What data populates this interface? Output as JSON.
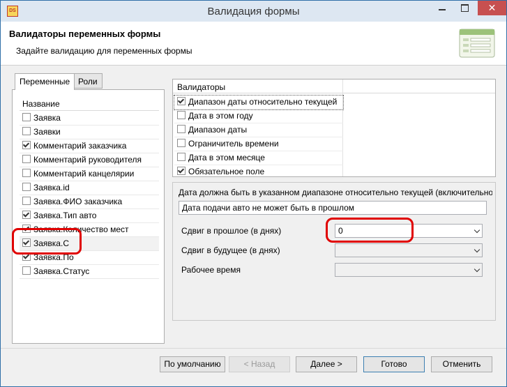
{
  "window": {
    "title": "Валидация формы",
    "app_icon": "app-icon",
    "close_label": "✕"
  },
  "header": {
    "title": "Валидаторы переменных формы",
    "subtitle": "Задайте валидацию для переменных формы"
  },
  "left_panel": {
    "tabs": [
      {
        "label": "Переменные",
        "active": true
      },
      {
        "label": "Роли",
        "active": false
      }
    ],
    "column_header": "Название",
    "variables": [
      {
        "label": "Заявка",
        "checked": false
      },
      {
        "label": "Заявки",
        "checked": false
      },
      {
        "label": "Комментарий заказчика",
        "checked": true
      },
      {
        "label": "Комментарий руководителя",
        "checked": false
      },
      {
        "label": "Комментарий канцелярии",
        "checked": false
      },
      {
        "label": "Заявка.id",
        "checked": false
      },
      {
        "label": "Заявка.ФИО заказчика",
        "checked": false
      },
      {
        "label": "Заявка.Тип авто",
        "checked": true
      },
      {
        "label": "Заявка.Количество мест",
        "checked": true
      },
      {
        "label": "Заявка.С",
        "checked": true
      },
      {
        "label": "Заявка.По",
        "checked": true
      },
      {
        "label": "Заявка.Статус",
        "checked": false
      }
    ]
  },
  "validators": {
    "header": "Валидаторы",
    "items": [
      {
        "label": "Диапазон даты относительно текущей",
        "checked": true
      },
      {
        "label": "Дата в этом году",
        "checked": false
      },
      {
        "label": "Диапазон даты",
        "checked": false
      },
      {
        "label": "Ограничитель времени",
        "checked": false
      },
      {
        "label": "Дата в этом месяце",
        "checked": false
      },
      {
        "label": "Обязательное поле",
        "checked": true
      }
    ]
  },
  "settings": {
    "description": "Дата должна быть в указанном диапазоне относительно текущей (включительно)",
    "message": "Дата подачи авто не может быть в прошлом",
    "past_label": "Сдвиг в прошлое (в днях)",
    "past_value": "0",
    "future_label": "Сдвиг в будущее (в днях)",
    "future_value": "",
    "worktime_label": "Рабочее время",
    "worktime_value": ""
  },
  "footer": {
    "default_label": "По умолчанию",
    "back_label": "< Назад",
    "next_label": "Далее >",
    "done_label": "Готово",
    "cancel_label": "Отменить"
  },
  "colors": {
    "highlight": "#e00000",
    "titlebar": "#dde7f2",
    "close": "#c75050"
  }
}
